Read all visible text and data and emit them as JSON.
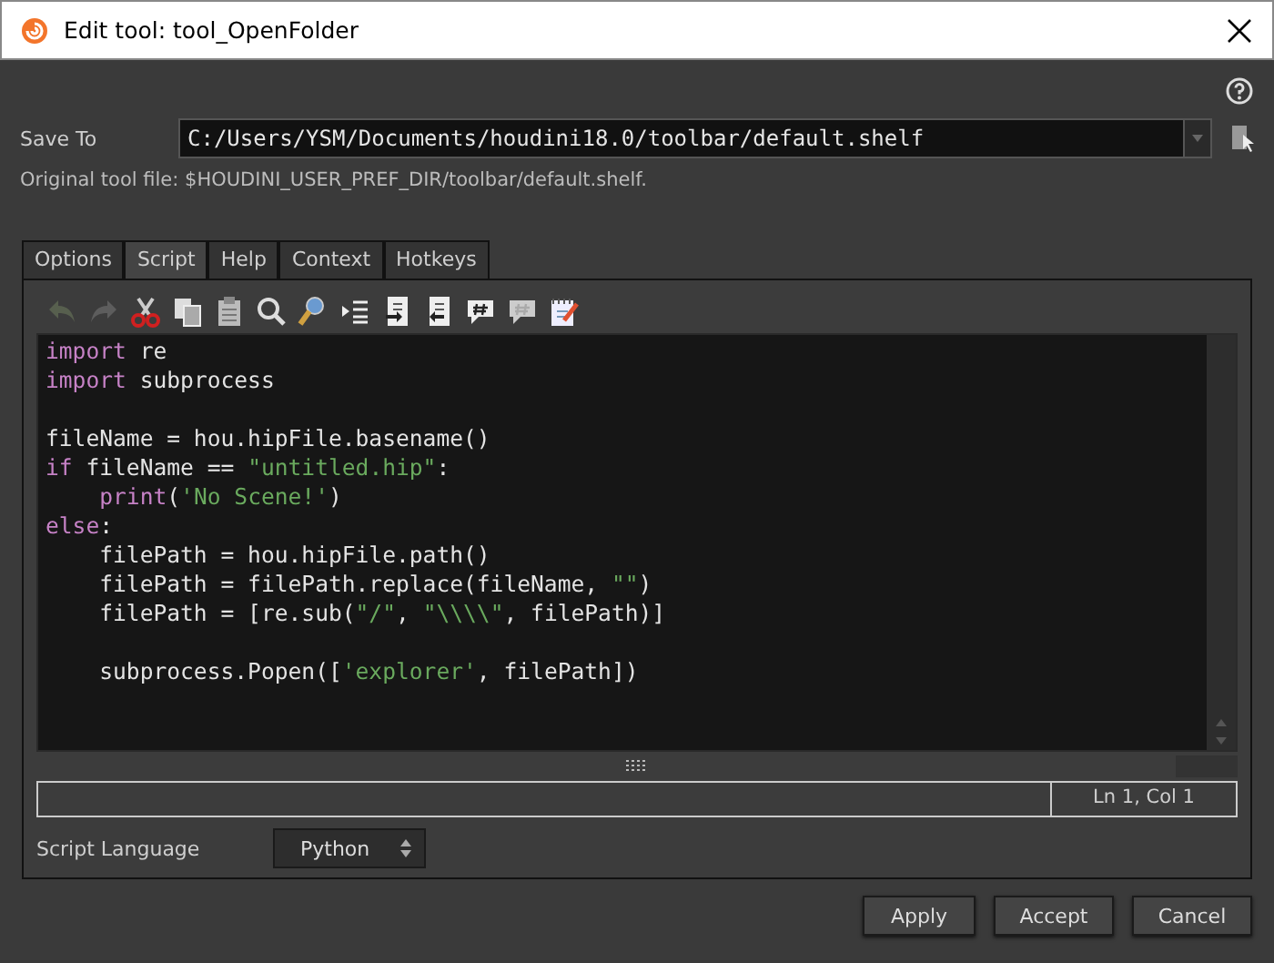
{
  "window": {
    "title": "Edit tool: tool_OpenFolder"
  },
  "save_to": {
    "label": "Save To",
    "value": "C:/Users/YSM/Documents/houdini18.0/toolbar/default.shelf"
  },
  "original_file": "Original tool file: $HOUDINI_USER_PREF_DIR/toolbar/default.shelf.",
  "tabs": [
    {
      "label": "Options",
      "selected": false
    },
    {
      "label": "Script",
      "selected": true
    },
    {
      "label": "Help",
      "selected": false
    },
    {
      "label": "Context",
      "selected": false
    },
    {
      "label": "Hotkeys",
      "selected": false
    }
  ],
  "toolbar": [
    {
      "kind": "undo",
      "disabled": true
    },
    {
      "kind": "redo",
      "disabled": true
    },
    {
      "kind": "cut",
      "disabled": false
    },
    {
      "kind": "copy",
      "disabled": false
    },
    {
      "kind": "paste",
      "disabled": false
    },
    {
      "kind": "find",
      "disabled": false
    },
    {
      "kind": "replace",
      "disabled": false
    },
    {
      "kind": "indent",
      "disabled": false
    },
    {
      "kind": "docin",
      "disabled": false
    },
    {
      "kind": "docout",
      "disabled": false
    },
    {
      "kind": "comment",
      "disabled": false
    },
    {
      "kind": "uncomment",
      "disabled": false
    },
    {
      "kind": "notes",
      "disabled": false
    }
  ],
  "code_lines": [
    {
      "tokens": [
        {
          "kind": "keyword",
          "text": "import"
        },
        {
          "kind": "plain",
          "text": " re"
        }
      ]
    },
    {
      "tokens": [
        {
          "kind": "keyword",
          "text": "import"
        },
        {
          "kind": "plain",
          "text": " subprocess"
        }
      ]
    },
    {
      "kind": "blank"
    },
    {
      "tokens": [
        {
          "kind": "plain",
          "text": "fileName = hou.hipFile.basename()"
        }
      ]
    },
    {
      "tokens": [
        {
          "kind": "keyword",
          "text": "if"
        },
        {
          "kind": "plain",
          "text": " fileName == "
        },
        {
          "kind": "string",
          "text": "\"untitled.hip\""
        },
        {
          "kind": "plain",
          "text": ":"
        }
      ]
    },
    {
      "tokens": [
        {
          "kind": "keyword",
          "text": "    print"
        },
        {
          "kind": "plain",
          "text": "("
        },
        {
          "kind": "string",
          "text": "'No Scene!'"
        },
        {
          "kind": "plain",
          "text": ")"
        }
      ]
    },
    {
      "tokens": [
        {
          "kind": "keyword",
          "text": "else"
        },
        {
          "kind": "plain",
          "text": ":"
        }
      ]
    },
    {
      "tokens": [
        {
          "kind": "plain",
          "text": "    filePath = hou.hipFile.path()"
        }
      ]
    },
    {
      "tokens": [
        {
          "kind": "plain",
          "text": "    filePath = filePath.replace(fileName, "
        },
        {
          "kind": "string",
          "text": "\"\""
        },
        {
          "kind": "plain",
          "text": ")"
        }
      ]
    },
    {
      "tokens": [
        {
          "kind": "plain",
          "text": "    filePath = [re.sub("
        },
        {
          "kind": "string",
          "text": "\"/\""
        },
        {
          "kind": "plain",
          "text": ", "
        },
        {
          "kind": "string",
          "text": "\"\\\\\\\\\""
        },
        {
          "kind": "plain",
          "text": ", filePath)]"
        }
      ]
    },
    {
      "kind": "blank"
    },
    {
      "tokens": [
        {
          "kind": "plain",
          "text": "    subprocess.Popen(["
        },
        {
          "kind": "string",
          "text": "'explorer'"
        },
        {
          "kind": "plain",
          "text": ", filePath])"
        }
      ]
    }
  ],
  "status": {
    "position": "Ln 1, Col 1"
  },
  "script_language": {
    "label": "Script Language",
    "value": "Python"
  },
  "buttons": [
    "Apply",
    "Accept",
    "Cancel"
  ]
}
